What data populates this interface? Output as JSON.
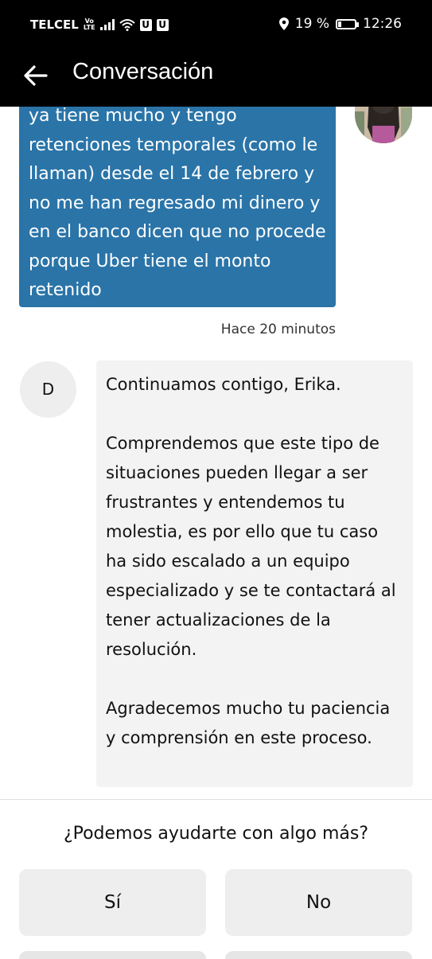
{
  "status_bar": {
    "carrier": "TELCEL",
    "volte_top": "Vo",
    "volte_bottom": "LTE",
    "badge1": "U",
    "badge2": "U",
    "battery_text": "19 %",
    "battery_level": 0.19,
    "time": "12:26"
  },
  "header": {
    "title": "Conversación"
  },
  "messages": {
    "user_message_lines": [
      "ya tiene mucho y tengo",
      "retenciones temporales (como le",
      "llaman) desde el 14 de febrero y",
      "no me han regresado mi dinero y",
      "en el banco dicen que no procede",
      "porque Uber tiene el monto",
      "retenido"
    ],
    "user_timestamp": "Hace 20 minutos",
    "agent_initial": "D",
    "agent_paragraphs": [
      "Continuamos contigo, Erika.",
      "Comprendemos que este tipo de situaciones pueden llegar a ser frustrantes y entendemos tu molestia, es por ello que tu caso ha sido escalado a un equipo especializado y se te contactará al tener actualizaciones de la resolución.",
      "Agradecemos mucho tu paciencia y comprensión en este proceso."
    ]
  },
  "bottom": {
    "question": "¿Podemos ayudarte con algo más?",
    "yes_label": "Sí",
    "no_label": "No"
  }
}
